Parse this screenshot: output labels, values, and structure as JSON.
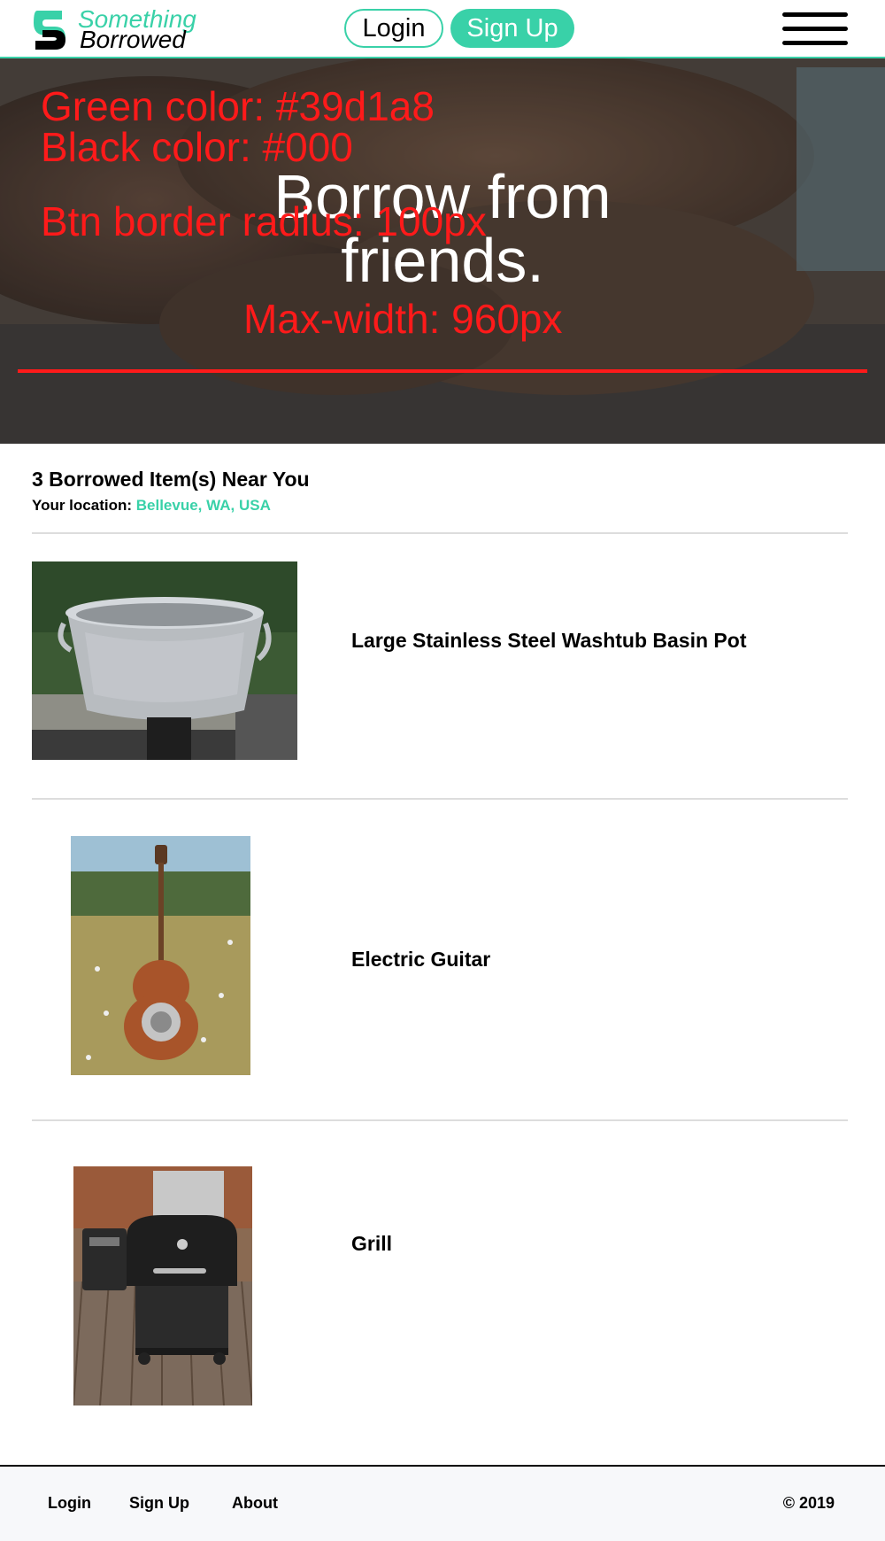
{
  "brand": {
    "name_line1": "Something",
    "name_line2": "Borrowed",
    "green": "#39d1a8",
    "black": "#000000"
  },
  "header": {
    "login_label": "Login",
    "signup_label": "Sign Up",
    "menu_icon": "hamburger-icon"
  },
  "hero": {
    "title": "Borrow from friends.",
    "annotations": {
      "green": "Green color: #39d1a8",
      "black": "Black color: #000",
      "radius": "Btn border radius: 100px",
      "maxwidth": "Max-width: 960px"
    }
  },
  "listing": {
    "count_title": "3 Borrowed Item(s) Near You",
    "location_label": "Your location:",
    "location_value": "Bellevue, WA, USA",
    "items": [
      {
        "title": "Large Stainless Steel Washtub Basin Pot"
      },
      {
        "title": "Electric Guitar"
      },
      {
        "title": "Grill"
      }
    ]
  },
  "footer": {
    "links": [
      "Login",
      "Sign Up",
      "About"
    ],
    "copyright": "© 2019"
  }
}
